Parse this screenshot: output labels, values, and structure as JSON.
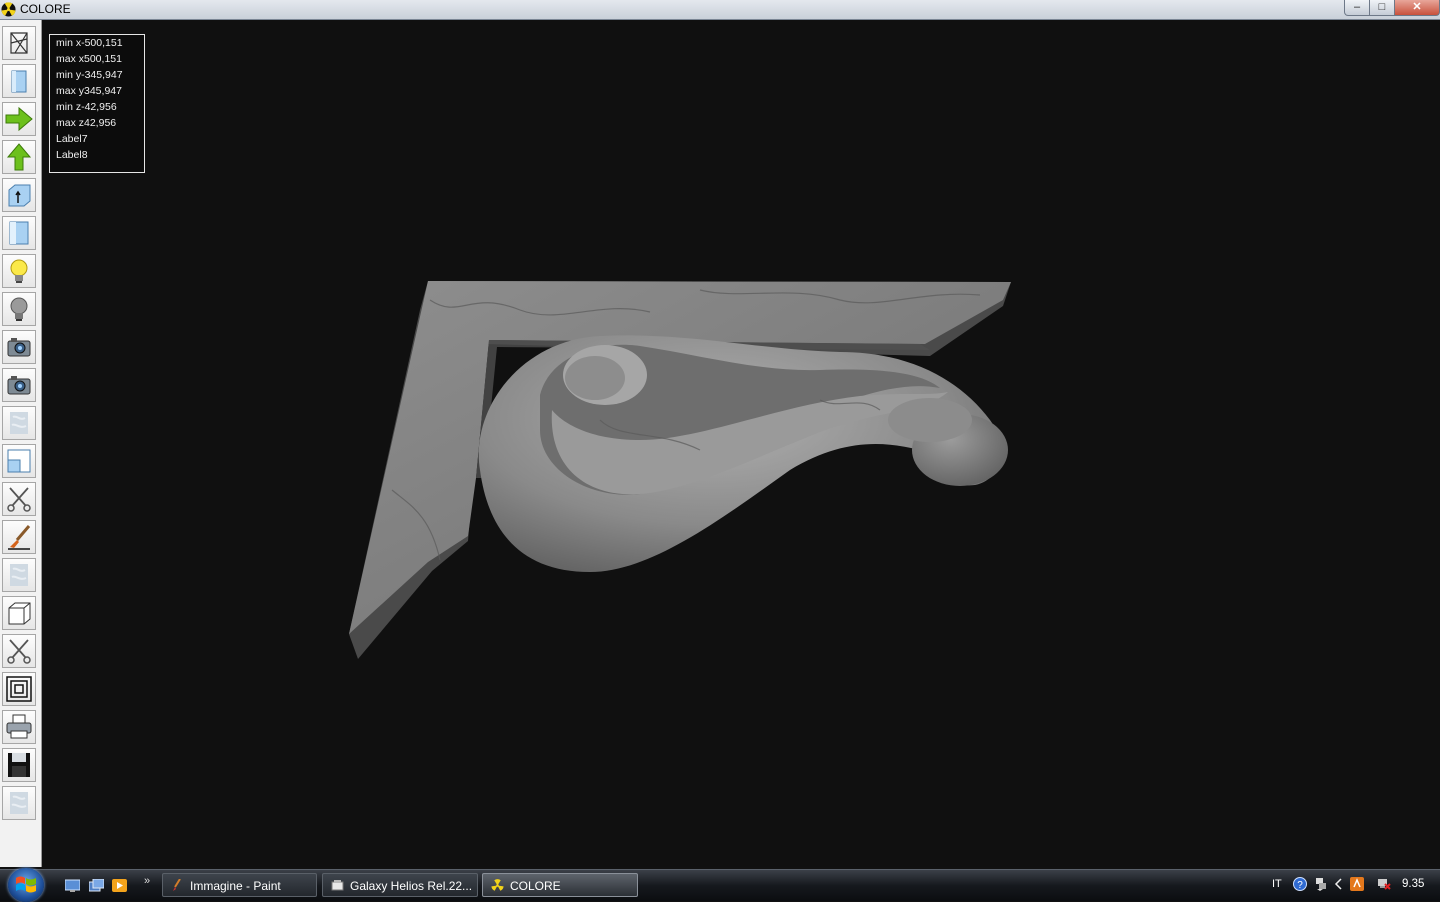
{
  "window": {
    "title": "COLORE",
    "app_icon": "radiation-icon",
    "controls": {
      "minimize": "–",
      "maximize": "□",
      "close": "✕"
    }
  },
  "toolbar": {
    "tools": [
      {
        "name": "wireframe-icon"
      },
      {
        "name": "solid-view-icon"
      },
      {
        "name": "arrow-right-icon"
      },
      {
        "name": "arrow-up-icon"
      },
      {
        "name": "extrude-box-icon"
      },
      {
        "name": "panel-icon"
      },
      {
        "name": "light-on-icon"
      },
      {
        "name": "light-off-icon"
      },
      {
        "name": "camera-icon"
      },
      {
        "name": "camera-alt-icon"
      },
      {
        "name": "texture-icon"
      },
      {
        "name": "window-split-icon"
      },
      {
        "name": "scissors-icon"
      },
      {
        "name": "brush-icon"
      },
      {
        "name": "texture-2-icon"
      },
      {
        "name": "cube-icon"
      },
      {
        "name": "scissors-2-icon"
      },
      {
        "name": "concentric-squares-icon"
      },
      {
        "name": "printer-icon"
      },
      {
        "name": "save-icon"
      },
      {
        "name": "texture-3-icon"
      }
    ]
  },
  "info": {
    "min_x": "min x-500,151",
    "max_x": "max x500,151",
    "min_y": "min y-345,947",
    "max_y": "max y345,947",
    "min_z": "min z-42,956",
    "max_z": "max z42,956",
    "label7": "Label7",
    "label8": "Label8"
  },
  "taskbar": {
    "quick_launch": [
      "show-desktop-icon",
      "switch-windows-icon",
      "media-player-icon"
    ],
    "more": "»",
    "tasks": [
      {
        "label": "Immagine - Paint",
        "icon": "paint-icon"
      },
      {
        "label": "Galaxy Helios  Rel.22...",
        "icon": "folder-icon"
      },
      {
        "label": "COLORE",
        "icon": "radiation-icon"
      }
    ],
    "language": "IT",
    "clock": "9.35"
  },
  "colors": {
    "viewport_bg": "#101010",
    "marble": "#8a8a8a",
    "taskbar": "#1a1d22"
  }
}
